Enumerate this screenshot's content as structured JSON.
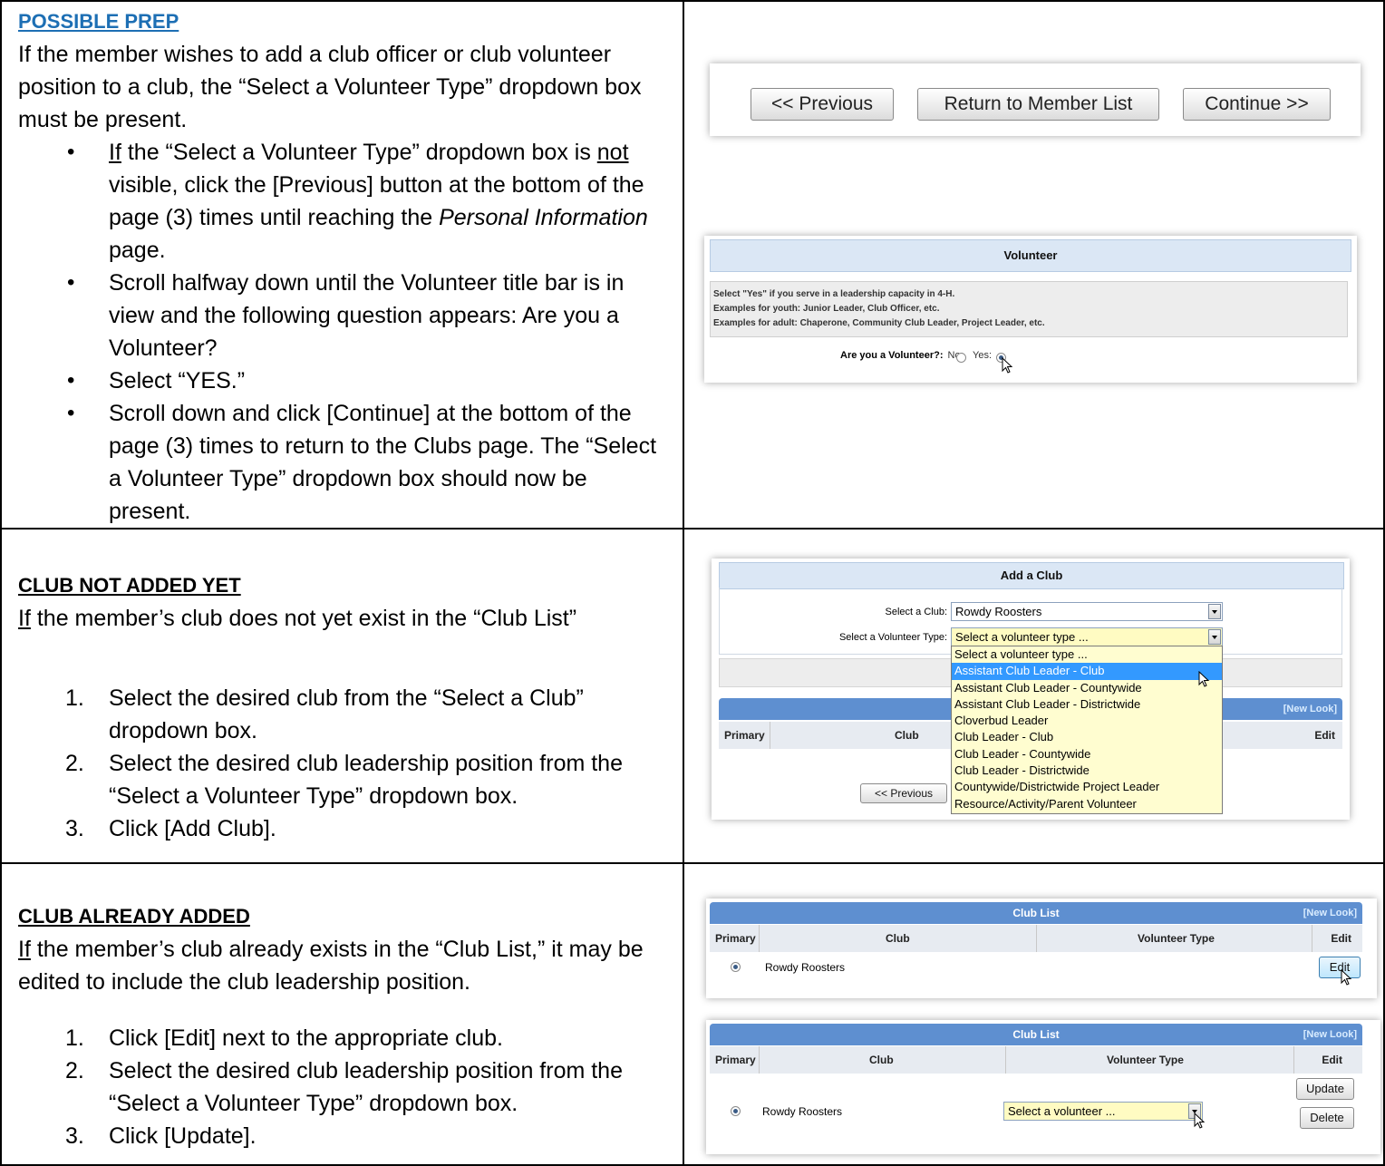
{
  "section1": {
    "heading": "POSSIBLE PREP",
    "intro": "If the member wishes to add a club officer or club volunteer position to a club, the “Select a Volunteer Type” dropdown box must be present.",
    "bullet1_if": "If",
    "bullet1_a": " the “Select a Volunteer Type” dropdown box is ",
    "bullet1_not": "not",
    "bullet1_b": " visible, click the [Previous] button at the bottom of the page (3) times until reaching the ",
    "bullet1_page": "Personal Information",
    "bullet1_c": " page.",
    "bullet2": "Scroll halfway down until the Volunteer title bar is in view and the following question appears: Are you a Volunteer?",
    "bullet3": "Select “YES.”",
    "bullet4": "Scroll down and click [Continue] at the bottom of the page (3) times to return to the Clubs page.  The “Select a Volunteer Type” dropdown box should now be present."
  },
  "nav_buttons": {
    "previous": "<< Previous",
    "return": "Return to Member List",
    "continue": "Continue >>"
  },
  "volunteer_panel": {
    "title": "Volunteer",
    "line1": "Select \"Yes\" if you serve in a leadership capacity in 4-H.",
    "line2": "Examples for youth: Junior Leader, Club Officer, etc.",
    "line3": "Examples for adult: Chaperone, Community Club Leader, Project Leader, etc.",
    "question": "Are you a Volunteer?:",
    "no": "No:",
    "yes": "Yes:"
  },
  "section2": {
    "heading": "CLUB NOT ADDED YET",
    "intro_if": "If",
    "intro": " the member’s club does not yet exist in the “Club List”",
    "steps": [
      "Select the desired club from the “Select a Club” dropdown box.",
      "Select the desired club leadership position from the “Select a Volunteer Type” dropdown box.",
      "Click [Add Club]."
    ],
    "step_nums": [
      "1.",
      "2.",
      "3."
    ]
  },
  "add_club_panel": {
    "title": "Add a Club",
    "select_club_label": "Select a Club:",
    "select_club_value": "Rowdy Roosters",
    "select_type_label": "Select a Volunteer Type:",
    "select_type_value": "Select a volunteer type ...",
    "options": [
      "Select a volunteer type ...",
      "Assistant Club Leader - Club",
      "Assistant Club Leader - Countywide",
      "Assistant Club Leader - Districtwide",
      "Cloverbud Leader",
      "Club Leader - Club",
      "Club Leader - Countywide",
      "Club Leader - Districtwide",
      "Countywide/Districtwide Project Leader",
      "Resource/Activity/Parent Volunteer"
    ],
    "new_look": "[New Look]",
    "col_primary": "Primary",
    "col_club": "Club",
    "col_edit": "Edit",
    "previous": "<< Previous"
  },
  "section3": {
    "heading": "CLUB ALREADY ADDED",
    "intro_if": "If",
    "intro": " the member’s club already exists in the “Club List,” it may be edited to include the club leadership position.",
    "steps": [
      "Click [Edit] next to the appropriate club.",
      "Select the desired club leadership position from the “Select a Volunteer Type” dropdown box.",
      "Click [Update]."
    ],
    "step_nums": [
      "1.",
      "2.",
      "3."
    ]
  },
  "club_list_1": {
    "title": "Club List",
    "new_look": "[New Look]",
    "col_primary": "Primary",
    "col_club": "Club",
    "col_type": "Volunteer Type",
    "col_edit": "Edit",
    "club": "Rowdy Roosters",
    "edit": "Edit"
  },
  "club_list_2": {
    "title": "Club List",
    "new_look": "[New Look]",
    "col_primary": "Primary",
    "col_club": "Club",
    "col_type": "Volunteer Type",
    "col_edit": "Edit",
    "club": "Rowdy Roosters",
    "select_value": "Select a volunteer ...",
    "update": "Update",
    "delete": "Delete"
  }
}
